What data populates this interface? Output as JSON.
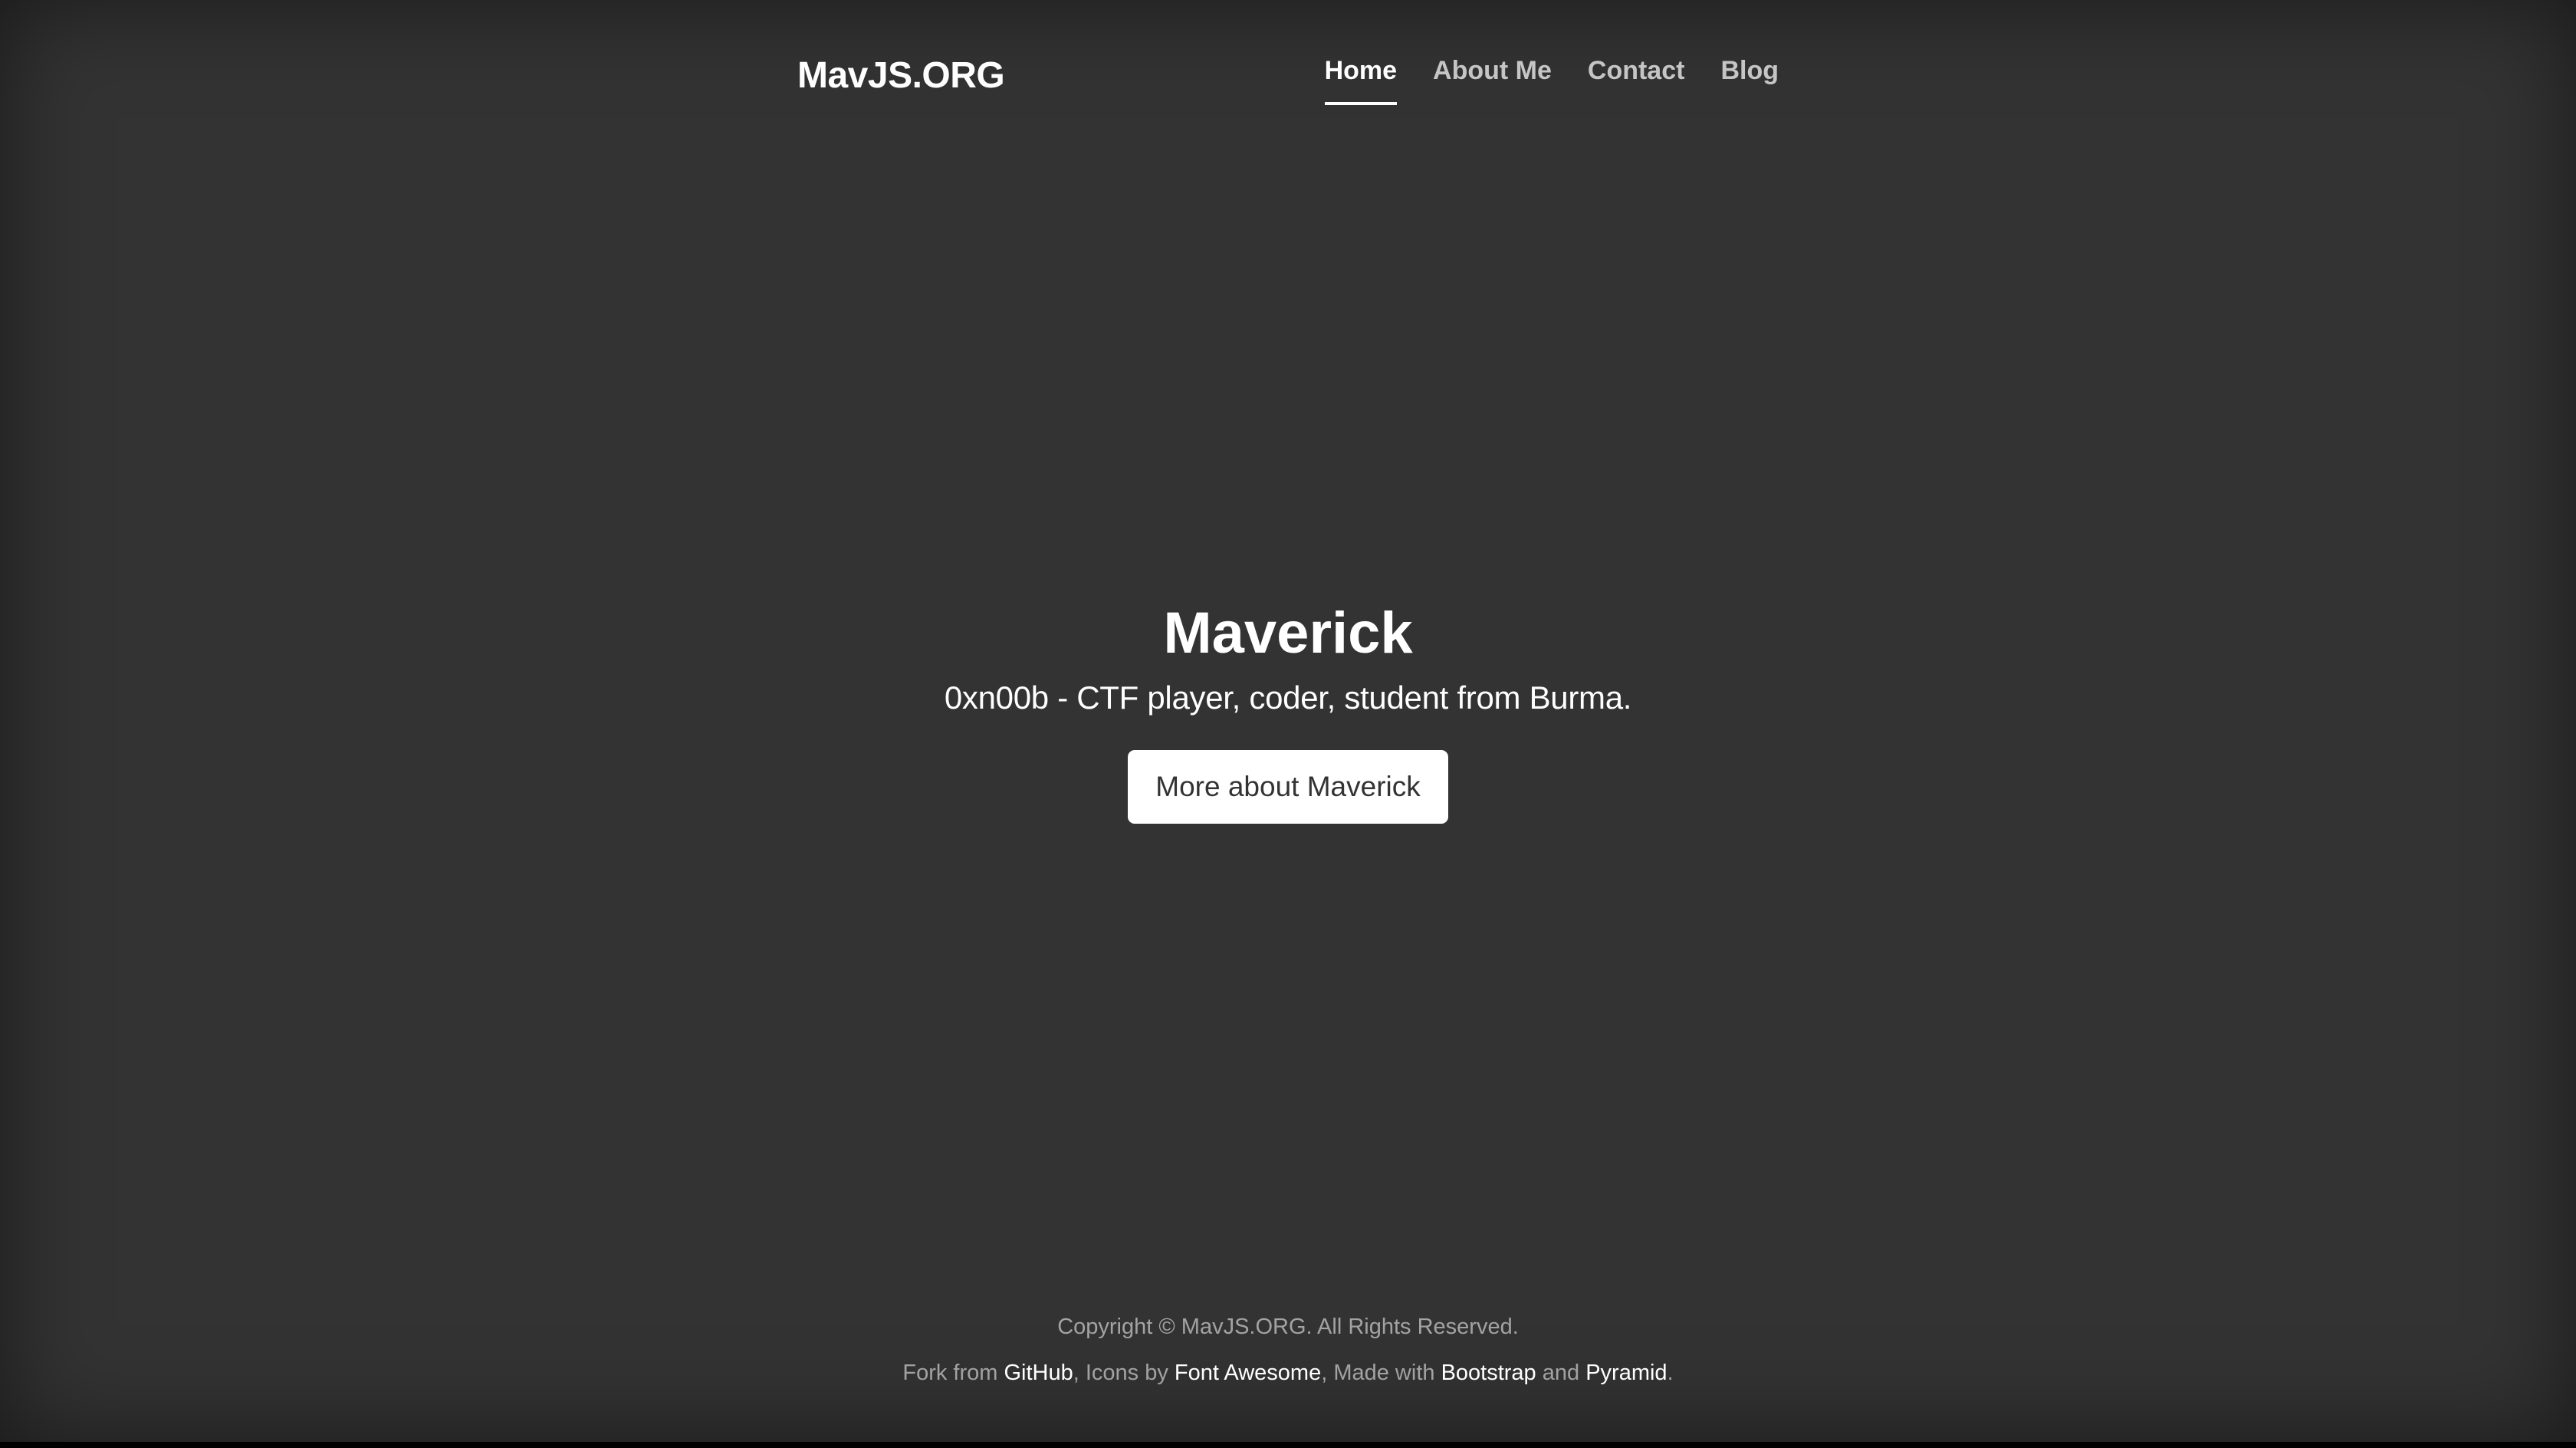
{
  "header": {
    "brand": "MavJS.ORG",
    "nav": [
      {
        "label": "Home",
        "active": true
      },
      {
        "label": "About Me",
        "active": false
      },
      {
        "label": "Contact",
        "active": false
      },
      {
        "label": "Blog",
        "active": false
      }
    ]
  },
  "hero": {
    "title": "Maverick",
    "subtitle": "0xn00b - CTF player, coder, student from Burma.",
    "button_label": "More about Maverick"
  },
  "footer": {
    "copyright": "Copyright © MavJS.ORG. All Rights Reserved.",
    "credits": {
      "prefix": "Fork from ",
      "link_github": "GitHub",
      "sep1": ", Icons by ",
      "link_fontawesome": "Font Awesome",
      "sep2": ", Made with ",
      "link_bootstrap": "Bootstrap",
      "sep3": " and ",
      "link_pyramid": "Pyramid",
      "suffix": "."
    }
  },
  "colors": {
    "background": "#333333",
    "text": "#ffffff",
    "button_bg": "#ffffff",
    "button_text": "#333333"
  }
}
